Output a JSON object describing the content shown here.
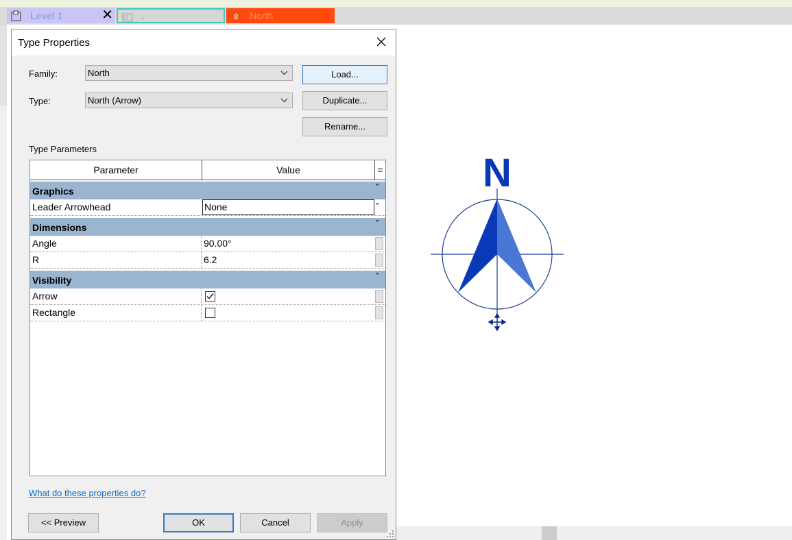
{
  "tabs": [
    {
      "label": "Level 1",
      "icon": "floor-plan-icon",
      "close": "✕"
    },
    {
      "label": "-",
      "icon": "view-icon"
    },
    {
      "label": "North",
      "icon": "home-icon"
    }
  ],
  "dialog": {
    "title": "Type Properties",
    "family_label": "Family:",
    "family_value": "North",
    "type_label": "Type:",
    "type_value": "North (Arrow)",
    "load_button": "Load...",
    "duplicate_button": "Duplicate...",
    "rename_button": "Rename...",
    "type_parameters_label": "Type Parameters",
    "grid": {
      "col_parameter": "Parameter",
      "col_value": "Value",
      "col_eq": "=",
      "groups": [
        {
          "name": "Graphics",
          "rows": [
            {
              "param": "Leader Arrowhead",
              "value": "None"
            }
          ]
        },
        {
          "name": "Dimensions",
          "rows": [
            {
              "param": "Angle",
              "value": "90.00°"
            },
            {
              "param": "R",
              "value": "6.2"
            }
          ]
        },
        {
          "name": "Visibility",
          "rows": [
            {
              "param": "Arrow",
              "checked": true
            },
            {
              "param": "Rectangle",
              "checked": false
            }
          ]
        }
      ]
    },
    "help_link": "What do these properties do?",
    "preview_button": "<< Preview",
    "ok_button": "OK",
    "cancel_button": "Cancel",
    "apply_button": "Apply"
  },
  "canvas": {
    "north_letter": "N",
    "colors": {
      "accent": "#0a39b8",
      "arrow_light": "#4a76d4",
      "line": "#1b3f8f"
    }
  }
}
